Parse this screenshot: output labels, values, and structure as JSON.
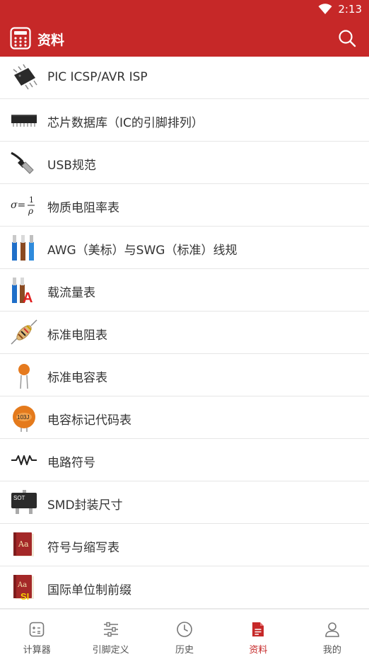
{
  "status": {
    "time": "2:13",
    "wifi_icon": "wifi-icon"
  },
  "header": {
    "title": "资料",
    "logo_icon": "calculator-icon",
    "search_icon": "search-icon"
  },
  "items": [
    {
      "label": "PIC ICSP/AVR ISP",
      "icon": "pic-chip-icon"
    },
    {
      "label": "芯片数据库（IC的引脚排列）",
      "icon": "dip-chip-icon"
    },
    {
      "label": "USB规范",
      "icon": "usb-cable-icon"
    },
    {
      "label": "物质电阻率表",
      "icon": "resistivity-formula-icon"
    },
    {
      "label": "AWG（美标）与SWG（标准）线规",
      "icon": "wire-gauge-icon"
    },
    {
      "label": "载流量表",
      "icon": "ampacity-icon"
    },
    {
      "label": "标准电阻表",
      "icon": "resistor-icon"
    },
    {
      "label": "标准电容表",
      "icon": "capacitor-icon"
    },
    {
      "label": "电容标记代码表",
      "icon": "capacitor-code-icon"
    },
    {
      "label": "电路符号",
      "icon": "circuit-symbol-icon"
    },
    {
      "label": "SMD封装尺寸",
      "icon": "smd-package-icon"
    },
    {
      "label": "符号与缩写表",
      "icon": "book-icon"
    },
    {
      "label": "国际单位制前缀",
      "icon": "si-book-icon"
    }
  ],
  "icon_text": {
    "formula_sigma": "σ=",
    "formula_num": "1",
    "formula_den": "ρ",
    "ampacity_letter": "A",
    "cap_code": "103J",
    "smd_text": "SOT",
    "book_text": "Aa",
    "si_text": "SI"
  },
  "tabs": [
    {
      "label": "计算器",
      "icon": "calculator-tab-icon",
      "active": false
    },
    {
      "label": "引脚定义",
      "icon": "sliders-icon",
      "active": false
    },
    {
      "label": "历史",
      "icon": "clock-icon",
      "active": false
    },
    {
      "label": "资料",
      "icon": "document-icon",
      "active": true
    },
    {
      "label": "我的",
      "icon": "user-icon",
      "active": false
    }
  ],
  "colors": {
    "primary": "#c62828",
    "text": "#333333",
    "tab_inactive": "#555555"
  }
}
